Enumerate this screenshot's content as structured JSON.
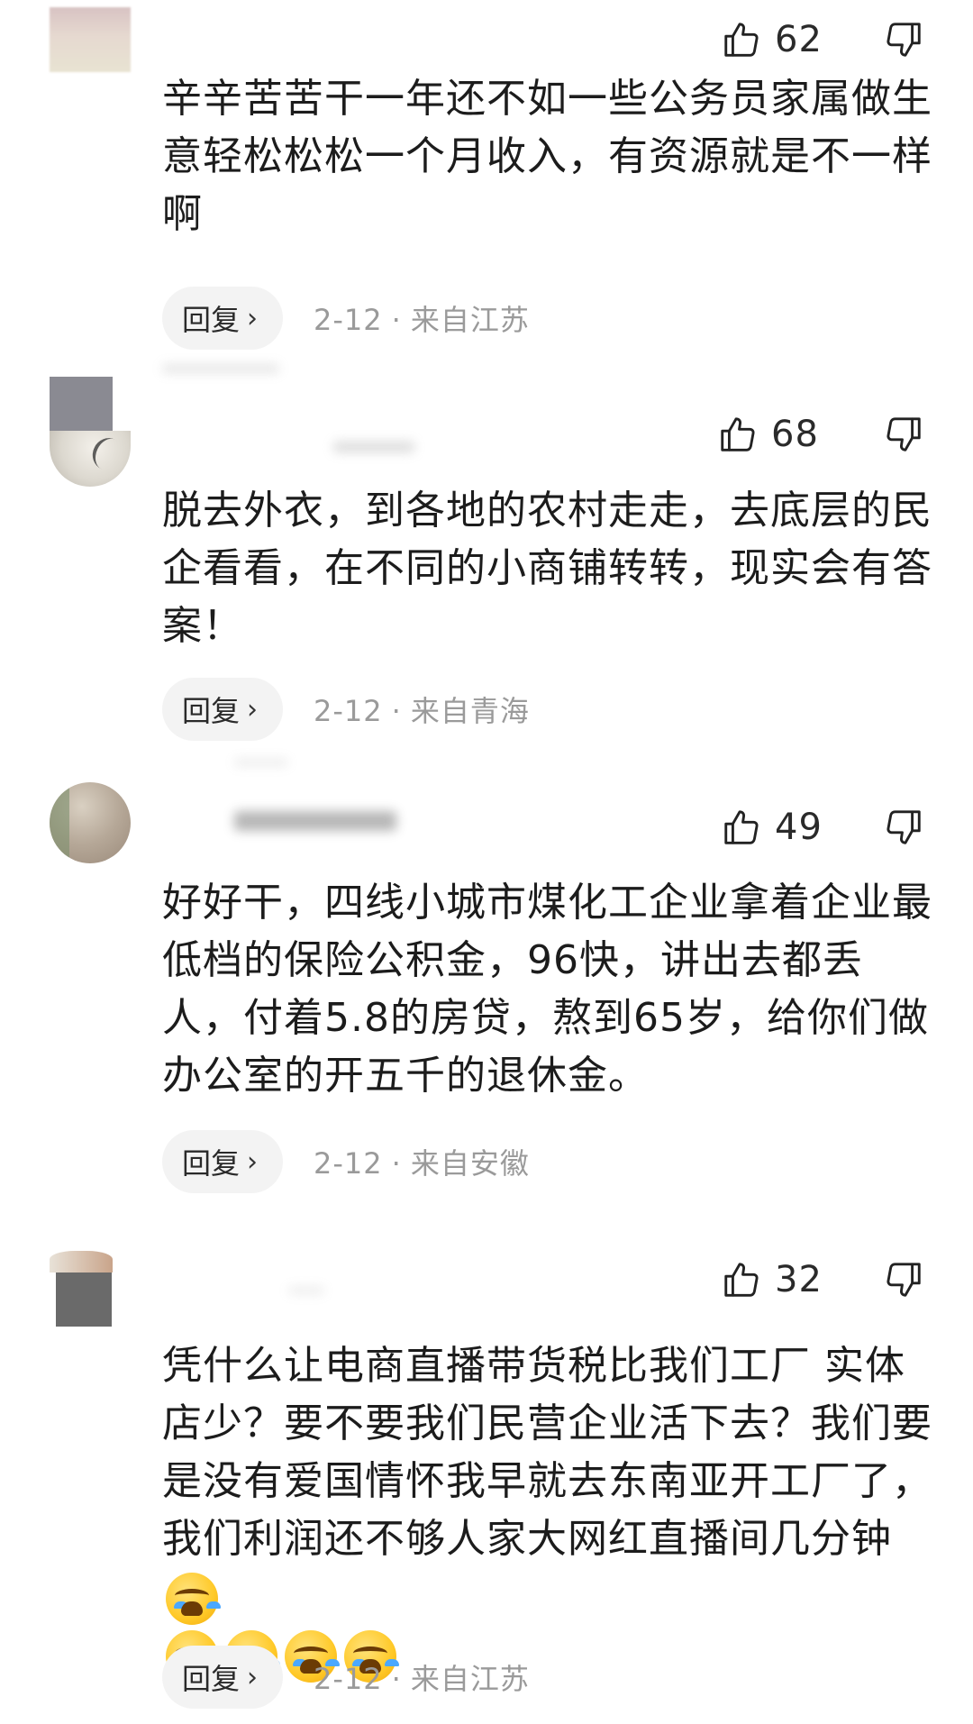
{
  "comments": [
    {
      "likes": "62",
      "text": "辛辛苦苦干一年还不如一些公务员家属做生意轻松松松一个月收入，有资源就是不一样啊",
      "reply_label": "回复",
      "date": "2-12",
      "location": "来自江苏"
    },
    {
      "likes": "68",
      "text": "脱去外衣，到各地的农村走走，去底层的民企看看，在不同的小商铺转转，现实会有答案！",
      "reply_label": "回复",
      "date": "2-12",
      "location": "来自青海"
    },
    {
      "likes": "49",
      "text": "好好干，四线小城市煤化工企业拿着企业最低档的保险公积金，96快，讲出去都丢人，付着5.8的房贷，熬到65岁，给你们做办公室的开五千的退休金。",
      "reply_label": "回复",
      "date": "2-12",
      "location": "来自安徽"
    },
    {
      "likes": "32",
      "text": "凭什么让电商直播带货税比我们工厂 实体店少？要不要我们民营企业活下去？我们要是没有爱国情怀我早就去东南亚开工厂了，我们利润还不够人家大网红直播间几分钟",
      "emoji_count": 5,
      "emoji_name": "crying-emoji",
      "reply_label": "回复",
      "date": "2-12",
      "location": "来自江苏"
    }
  ],
  "icons": {
    "like": "thumbs-up-icon",
    "dislike": "thumbs-down-icon",
    "reply_chevron": "chevron-right-icon"
  },
  "separator": "·",
  "chevron": "›"
}
